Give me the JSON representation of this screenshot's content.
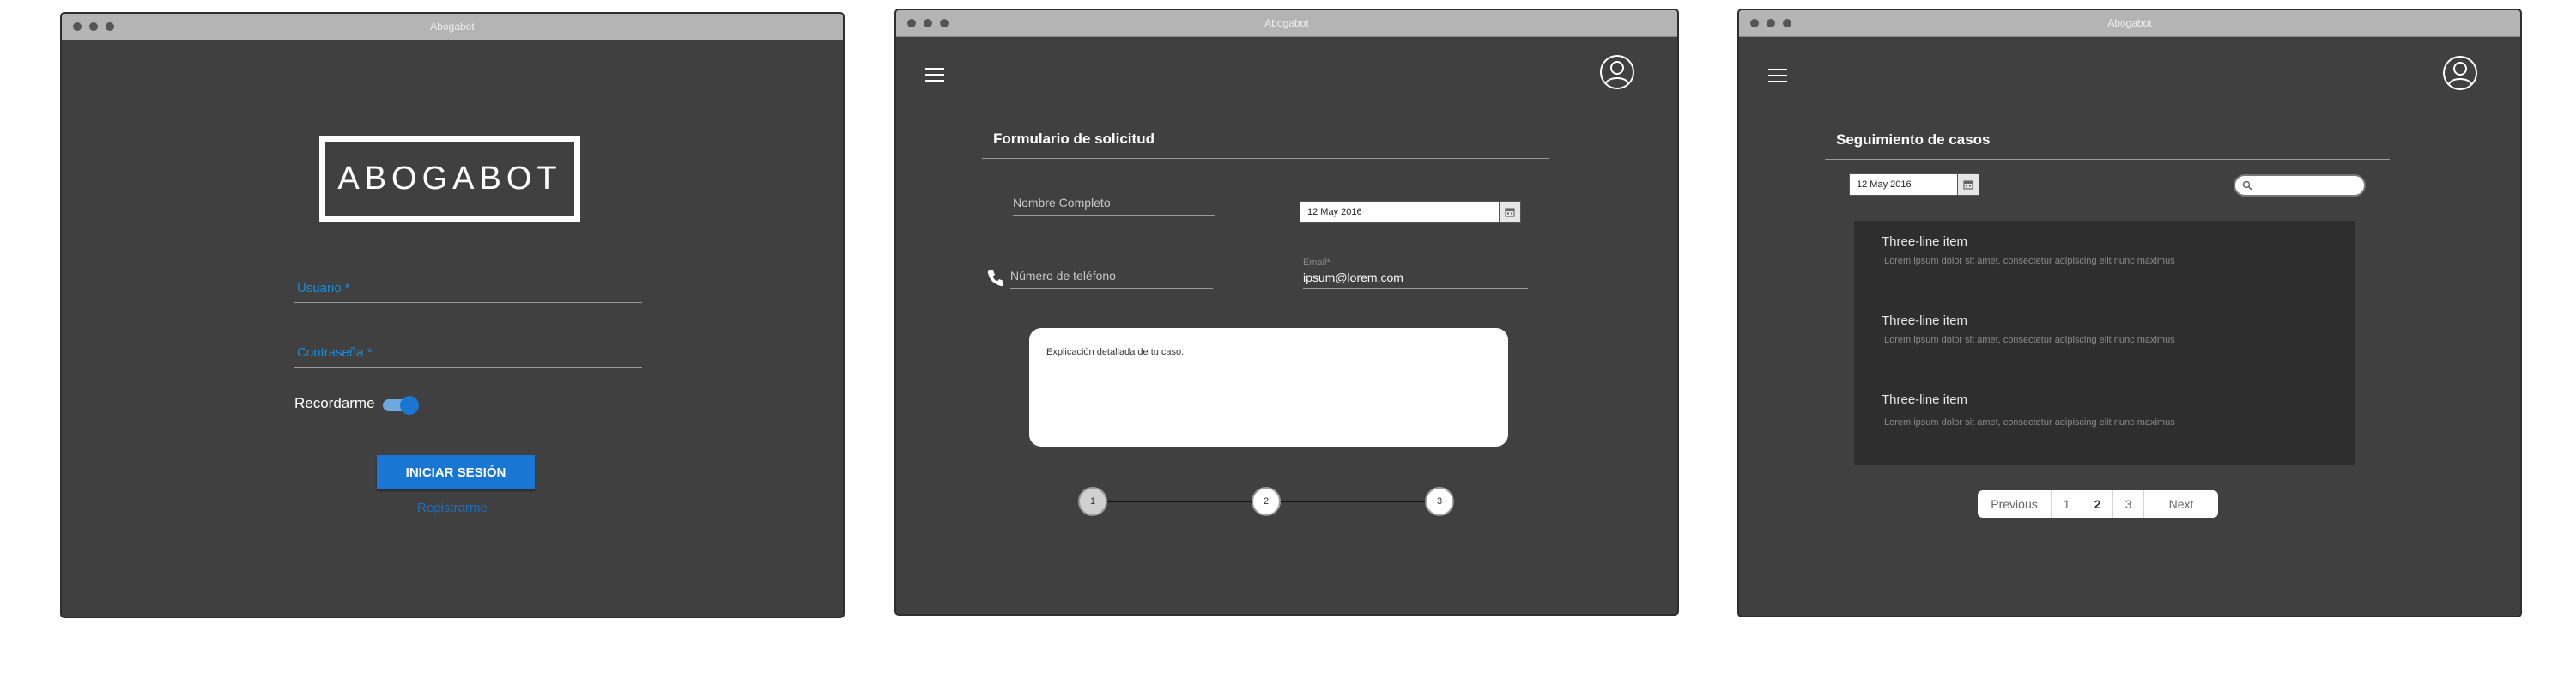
{
  "app_title": "Abogabot",
  "login": {
    "logo": "ABOGABOT",
    "username_label": "Usuario *",
    "password_label": "Contraseña *",
    "remember_label": "Recordarme",
    "remember_on": true,
    "login_button": "INICIAR SESIÓN",
    "register_link": "Registrarme"
  },
  "request_form": {
    "title": "Formulario de solicitud",
    "full_name_placeholder": "Nombre Completo",
    "date_value": "12 May 2016",
    "phone_placeholder": "Número de teléfono",
    "email_label": "Email*",
    "email_value": "ipsum@lorem.com",
    "details_placeholder": "Explicación detallada de tu caso.",
    "steps": [
      "1",
      "2",
      "3"
    ],
    "active_step": 1
  },
  "case_tracking": {
    "title": "Seguimiento de casos",
    "date_value": "12 May 2016",
    "search_value": "",
    "items": [
      {
        "title": "Three-line item",
        "body": "Lorem ipsum dolor sit amet, consectetur adipiscing elit nunc maximus"
      },
      {
        "title": "Three-line item",
        "body": "Lorem ipsum dolor sit amet, consectetur adipiscing elit nunc maximus"
      },
      {
        "title": "Three-line item",
        "body": "Lorem ipsum dolor sit amet, consectetur adipiscing elit nunc maximus"
      }
    ],
    "pagination": {
      "previous": "Previous",
      "pages": [
        "1",
        "2",
        "3"
      ],
      "current_page": "2",
      "next": "Next"
    }
  },
  "colors": {
    "window_bg": "#404040",
    "titlebar_bg": "#b4b4b4",
    "accent_blue": "#1976d2",
    "label_blue": "#1a8ddb",
    "list_panel_bg": "#2e2e2e"
  },
  "icons": [
    "menu-icon",
    "user-avatar-icon",
    "phone-icon",
    "calendar-icon",
    "search-icon"
  ]
}
